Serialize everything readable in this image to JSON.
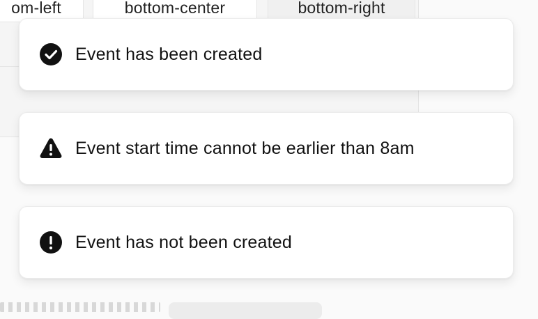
{
  "positions": {
    "left": "om-left",
    "center": "bottom-center",
    "right": "bottom-right"
  },
  "toasts": [
    {
      "icon": "check-circle-icon",
      "message": "Event has been created"
    },
    {
      "icon": "warning-triangle-icon",
      "message": "Event start time cannot be earlier than 8am"
    },
    {
      "icon": "exclamation-circle-icon",
      "message": "Event has not been created"
    }
  ],
  "colors": {
    "icon": "#111111",
    "toast_bg": "#ffffff",
    "page_bg": "#fafafa"
  }
}
